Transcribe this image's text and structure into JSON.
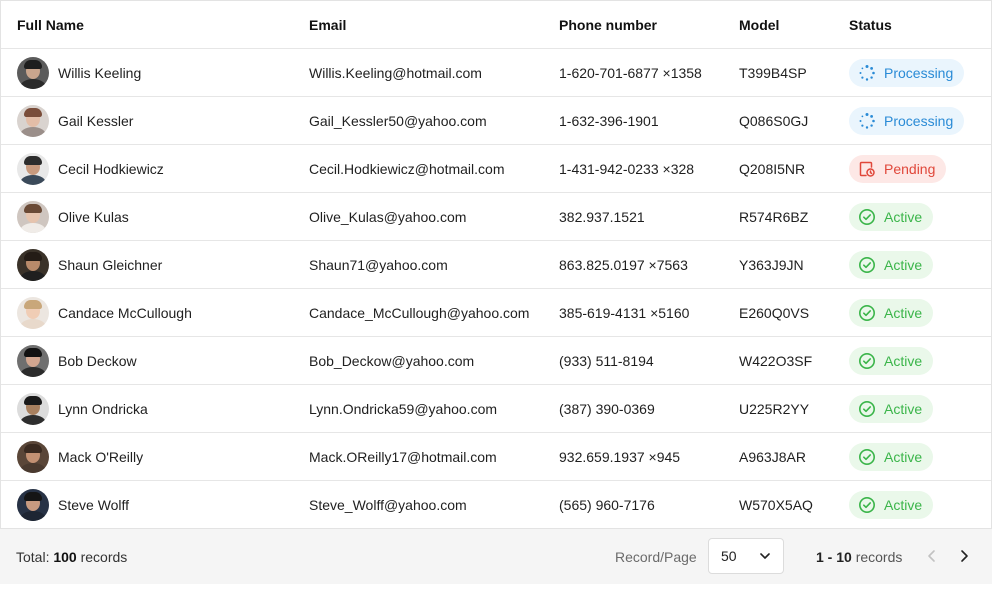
{
  "columns": {
    "name": "Full Name",
    "email": "Email",
    "phone": "Phone number",
    "model": "Model",
    "status": "Status"
  },
  "rows": [
    {
      "name": "Willis Keeling",
      "email": "Willis.Keeling@hotmail.com",
      "phone": "1-620-701-6877 ×1358",
      "model": "T399B4SP",
      "status": "Processing",
      "status_kind": "processing",
      "avatar": {
        "bg": "#5b5b5b",
        "skin": "#c9a58d",
        "hair": "#1e1e1e",
        "shirt": "#2a2a2a"
      }
    },
    {
      "name": "Gail Kessler",
      "email": "Gail_Kessler50@yahoo.com",
      "phone": "1-632-396-1901",
      "model": "Q086S0GJ",
      "status": "Processing",
      "status_kind": "processing",
      "avatar": {
        "bg": "#d9d3cf",
        "skin": "#e3bda7",
        "hair": "#7a4d3a",
        "shirt": "#9b8f8a"
      }
    },
    {
      "name": "Cecil Hodkiewicz",
      "email": "Cecil.Hodkiewicz@hotmail.com",
      "phone": "1-431-942-0233 ×328",
      "model": "Q208I5NR",
      "status": "Pending",
      "status_kind": "pending",
      "avatar": {
        "bg": "#e8e8e8",
        "skin": "#c89a7e",
        "hair": "#2d2d2d",
        "shirt": "#3b4a5a"
      }
    },
    {
      "name": "Olive Kulas",
      "email": "Olive_Kulas@yahoo.com",
      "phone": "382.937.1521",
      "model": "R574R6BZ",
      "status": "Active",
      "status_kind": "active",
      "avatar": {
        "bg": "#cfc6c0",
        "skin": "#e6c4ae",
        "hair": "#6a4a36",
        "shirt": "#f0ece8"
      }
    },
    {
      "name": "Shaun Gleichner",
      "email": "Shaun71@yahoo.com",
      "phone": "863.825.0197 ×7563",
      "model": "Y363J9JN",
      "status": "Active",
      "status_kind": "active",
      "avatar": {
        "bg": "#3a3229",
        "skin": "#b88a6a",
        "hair": "#241c16",
        "shirt": "#1f1f1f"
      }
    },
    {
      "name": "Candace McCullough",
      "email": "Candace_McCullough@yahoo.com",
      "phone": "385-619-4131 ×5160",
      "model": "E260Q0VS",
      "status": "Active",
      "status_kind": "active",
      "avatar": {
        "bg": "#ece6e0",
        "skin": "#f0cdb5",
        "hair": "#c9a77a",
        "shirt": "#e8d9cb"
      }
    },
    {
      "name": "Bob Deckow",
      "email": "Bob_Deckow@yahoo.com",
      "phone": "(933) 511-8194",
      "model": "W422O3SF",
      "status": "Active",
      "status_kind": "active",
      "avatar": {
        "bg": "#6f6f6f",
        "skin": "#d2a690",
        "hair": "#121212",
        "shirt": "#2b2b2b"
      }
    },
    {
      "name": "Lynn Ondricka",
      "email": "Lynn.Ondricka59@yahoo.com",
      "phone": "(387) 390-0369",
      "model": "U225R2YY",
      "status": "Active",
      "status_kind": "active",
      "avatar": {
        "bg": "#dcdcdc",
        "skin": "#a8805f",
        "hair": "#1a1a1a",
        "shirt": "#2e2e2e"
      }
    },
    {
      "name": "Mack O'Reilly",
      "email": "Mack.OReilly17@hotmail.com",
      "phone": "932.659.1937 ×945",
      "model": "A963J8AR",
      "status": "Active",
      "status_kind": "active",
      "avatar": {
        "bg": "#5a4638",
        "skin": "#c39173",
        "hair": "#3a2a20",
        "shirt": "#4a3a2f"
      }
    },
    {
      "name": "Steve Wolff",
      "email": "Steve_Wolff@yahoo.com",
      "phone": "(565) 960-7176",
      "model": "W570X5AQ",
      "status": "Active",
      "status_kind": "active",
      "avatar": {
        "bg": "#273245",
        "skin": "#c79a80",
        "hair": "#151515",
        "shirt": "#1d2533"
      }
    }
  ],
  "footer": {
    "total_prefix": "Total: ",
    "total_count": "100",
    "total_suffix": " records",
    "rpp_label": "Record/Page",
    "rpp_value": "50",
    "range_bold": "1 - 10",
    "range_suffix": " records"
  },
  "colors": {
    "processing": "#2a8bd6",
    "pending": "#e0473a",
    "active": "#3bb54a"
  }
}
